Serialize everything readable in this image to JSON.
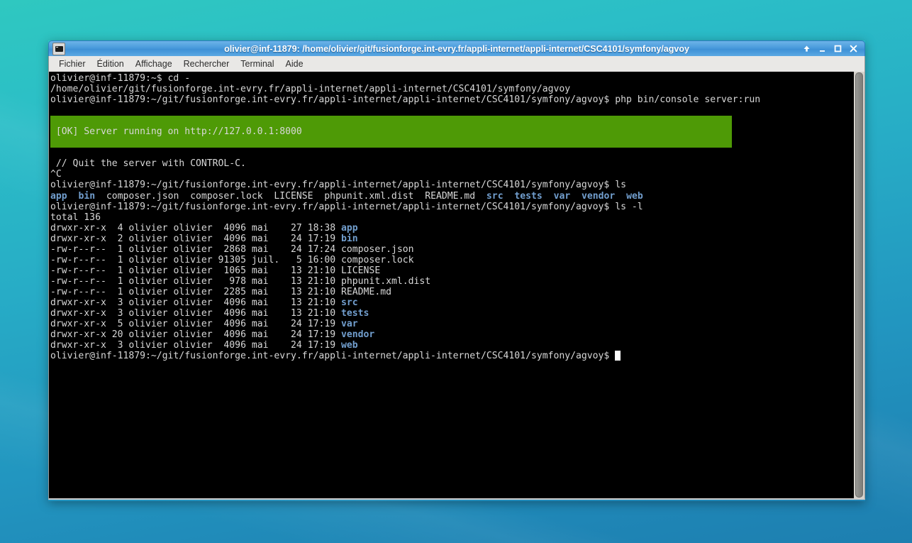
{
  "window": {
    "title": "olivier@inf-11879: /home/olivier/git/fusionforge.int-evry.fr/appli-internet/appli-internet/CSC4101/symfony/agvoy",
    "icon": "terminal-icon",
    "controls": [
      {
        "name": "shade-button",
        "glyph": "↑"
      },
      {
        "name": "minimize-button",
        "glyph": "_"
      },
      {
        "name": "maximize-button",
        "glyph": "□"
      },
      {
        "name": "close-button",
        "glyph": "✕"
      }
    ]
  },
  "menubar": {
    "items": [
      {
        "label": "Fichier"
      },
      {
        "label": "Édition"
      },
      {
        "label": "Affichage"
      },
      {
        "label": "Rechercher"
      },
      {
        "label": "Terminal"
      },
      {
        "label": "Aide"
      }
    ]
  },
  "terminal": {
    "colors": {
      "background": "#000000",
      "foreground": "#d8d8d8",
      "directory": "#729fcf",
      "ok_banner_bg": "#4e9a06",
      "ok_banner_fg": "#000000",
      "cursor": "#ffffff"
    },
    "lines": {
      "l1": "olivier@inf-11879:~$ cd -",
      "l2": "/home/olivier/git/fusionforge.int-evry.fr/appli-internet/appli-internet/CSC4101/symfony/agvoy",
      "l3": "olivier@inf-11879:~/git/fusionforge.int-evry.fr/appli-internet/appli-internet/CSC4101/symfony/agvoy$ php bin/console server:run",
      "banner": " [OK] Server running on http://127.0.0.1:8000",
      "l4": " // Quit the server with CONTROL-C.",
      "l5": "^C",
      "l6": "olivier@inf-11879:~/git/fusionforge.int-evry.fr/appli-internet/appli-internet/CSC4101/symfony/agvoy$ ls",
      "ls_app": "app",
      "ls_bin": "bin",
      "ls_files_mid": "  composer.json  composer.lock  LICENSE  phpunit.xml.dist  README.md  ",
      "ls_src": "src",
      "ls_tests": "tests",
      "ls_var": "var",
      "ls_vendor": "vendor",
      "ls_web": "web",
      "l7": "olivier@inf-11879:~/git/fusionforge.int-evry.fr/appli-internet/appli-internet/CSC4101/symfony/agvoy$ ls -l",
      "total": "total 136",
      "prompt_final": "olivier@inf-11879:~/git/fusionforge.int-evry.fr/appli-internet/appli-internet/CSC4101/symfony/agvoy$ "
    },
    "listing": [
      {
        "perms": "drwxr-xr-x",
        "links": " 4",
        "user": "olivier",
        "group": "olivier",
        "size": " 4096",
        "month": "mai ",
        "day": " 27",
        "time": "18:38",
        "name": "app",
        "is_dir": true
      },
      {
        "perms": "drwxr-xr-x",
        "links": " 2",
        "user": "olivier",
        "group": "olivier",
        "size": " 4096",
        "month": "mai ",
        "day": " 24",
        "time": "17:19",
        "name": "bin",
        "is_dir": true
      },
      {
        "perms": "-rw-r--r--",
        "links": " 1",
        "user": "olivier",
        "group": "olivier",
        "size": " 2868",
        "month": "mai ",
        "day": " 24",
        "time": "17:24",
        "name": "composer.json",
        "is_dir": false
      },
      {
        "perms": "-rw-r--r--",
        "links": " 1",
        "user": "olivier",
        "group": "olivier",
        "size": "91305",
        "month": "juil.",
        "day": "  5",
        "time": "16:00",
        "name": "composer.lock",
        "is_dir": false
      },
      {
        "perms": "-rw-r--r--",
        "links": " 1",
        "user": "olivier",
        "group": "olivier",
        "size": " 1065",
        "month": "mai ",
        "day": " 13",
        "time": "21:10",
        "name": "LICENSE",
        "is_dir": false
      },
      {
        "perms": "-rw-r--r--",
        "links": " 1",
        "user": "olivier",
        "group": "olivier",
        "size": "  978",
        "month": "mai ",
        "day": " 13",
        "time": "21:10",
        "name": "phpunit.xml.dist",
        "is_dir": false
      },
      {
        "perms": "-rw-r--r--",
        "links": " 1",
        "user": "olivier",
        "group": "olivier",
        "size": " 2285",
        "month": "mai ",
        "day": " 13",
        "time": "21:10",
        "name": "README.md",
        "is_dir": false
      },
      {
        "perms": "drwxr-xr-x",
        "links": " 3",
        "user": "olivier",
        "group": "olivier",
        "size": " 4096",
        "month": "mai ",
        "day": " 13",
        "time": "21:10",
        "name": "src",
        "is_dir": true
      },
      {
        "perms": "drwxr-xr-x",
        "links": " 3",
        "user": "olivier",
        "group": "olivier",
        "size": " 4096",
        "month": "mai ",
        "day": " 13",
        "time": "21:10",
        "name": "tests",
        "is_dir": true
      },
      {
        "perms": "drwxr-xr-x",
        "links": " 5",
        "user": "olivier",
        "group": "olivier",
        "size": " 4096",
        "month": "mai ",
        "day": " 24",
        "time": "17:19",
        "name": "var",
        "is_dir": true
      },
      {
        "perms": "drwxr-xr-x",
        "links": "20",
        "user": "olivier",
        "group": "olivier",
        "size": " 4096",
        "month": "mai ",
        "day": " 24",
        "time": "17:19",
        "name": "vendor",
        "is_dir": true
      },
      {
        "perms": "drwxr-xr-x",
        "links": " 3",
        "user": "olivier",
        "group": "olivier",
        "size": " 4096",
        "month": "mai ",
        "day": " 24",
        "time": "17:19",
        "name": "web",
        "is_dir": true
      }
    ]
  }
}
